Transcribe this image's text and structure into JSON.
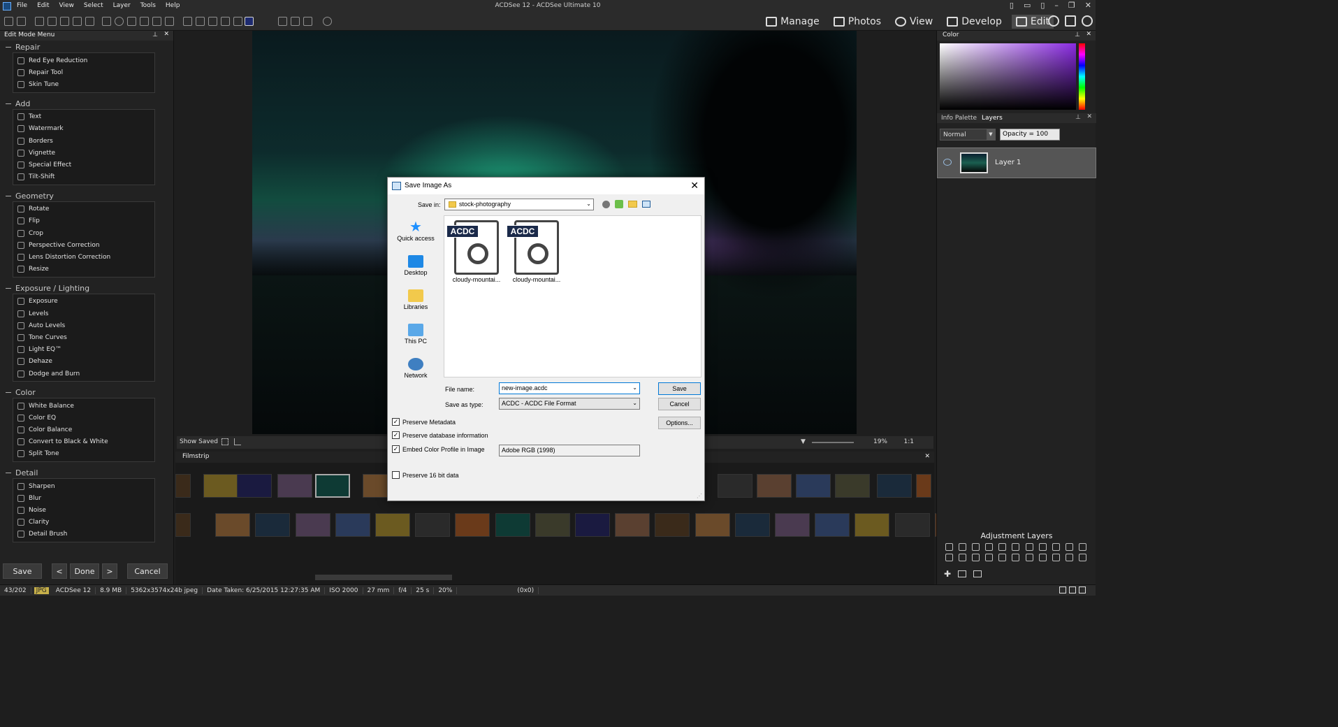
{
  "titlebar": {
    "menu": [
      "File",
      "Edit",
      "View",
      "Select",
      "Layer",
      "Tools",
      "Help"
    ],
    "title": "ACDSee 12 - ACDSee Ultimate 10"
  },
  "modes": [
    {
      "label": "Manage",
      "icon": "grid-icon"
    },
    {
      "label": "Photos",
      "icon": "photos-icon"
    },
    {
      "label": "View",
      "icon": "eye-icon"
    },
    {
      "label": "Develop",
      "icon": "develop-icon"
    },
    {
      "label": "Edit",
      "icon": "edit-icon",
      "active": true
    }
  ],
  "left_panel": {
    "title": "Edit Mode Menu",
    "groups": [
      {
        "name": "Repair",
        "items": [
          "Red Eye Reduction",
          "Repair Tool",
          "Skin Tune"
        ]
      },
      {
        "name": "Add",
        "items": [
          "Text",
          "Watermark",
          "Borders",
          "Vignette",
          "Special Effect",
          "Tilt-Shift"
        ]
      },
      {
        "name": "Geometry",
        "items": [
          "Rotate",
          "Flip",
          "Crop",
          "Perspective Correction",
          "Lens Distortion Correction",
          "Resize"
        ]
      },
      {
        "name": "Exposure / Lighting",
        "items": [
          "Exposure",
          "Levels",
          "Auto Levels",
          "Tone Curves",
          "Light EQ™",
          "Dehaze",
          "Dodge and Burn"
        ]
      },
      {
        "name": "Color",
        "items": [
          "White Balance",
          "Color EQ",
          "Color Balance",
          "Convert to Black & White",
          "Split Tone"
        ]
      },
      {
        "name": "Detail",
        "items": [
          "Sharpen",
          "Blur",
          "Noise",
          "Clarity",
          "Detail Brush"
        ]
      }
    ],
    "buttons": {
      "save": "Save",
      "prev": "<",
      "done": "Done",
      "next": ">",
      "cancel": "Cancel"
    }
  },
  "image_bar": {
    "show_saved": "Show Saved",
    "zoom": "19%",
    "ratio": "1:1"
  },
  "filmstrip": {
    "title": "Filmstrip"
  },
  "right_panel": {
    "color_title": "Color",
    "tabs": [
      "Info Palette",
      "Layers"
    ],
    "blend_mode": "Normal",
    "opacity": "Opacity = 100",
    "layer_name": "Layer 1",
    "adjustment_title": "Adjustment Layers"
  },
  "status": {
    "index": "43/202",
    "format": "JPG",
    "app": "ACDSee 12",
    "size": "8.9 MB",
    "dims": "5362x3574x24b jpeg",
    "date": "Date Taken: 6/25/2015 12:27:35 AM",
    "iso": "ISO 2000",
    "focal": "27 mm",
    "aperture": "f/4",
    "shutter": "25 s",
    "zoom": "20%",
    "coords": "(0x0)"
  },
  "dialog": {
    "title": "Save Image As",
    "save_in_label": "Save in:",
    "save_in_value": "stock-photography",
    "places": [
      "Quick access",
      "Desktop",
      "Libraries",
      "This PC",
      "Network"
    ],
    "files": [
      {
        "badge": "ACDC",
        "name": "cloudy-mountai..."
      },
      {
        "badge": "ACDC",
        "name": "cloudy-mountai..."
      }
    ],
    "file_name_label": "File name:",
    "file_name_value": "new-image.acdc",
    "save_type_label": "Save as type:",
    "save_type_value": "ACDC - ACDC File Format",
    "save_btn": "Save",
    "cancel_btn": "Cancel",
    "options_btn": "Options...",
    "preserve_metadata": "Preserve Metadata",
    "preserve_db": "Preserve database information",
    "embed_profile": "Embed Color Profile in Image",
    "profile_value": "Adobe RGB (1998)",
    "preserve_16bit": "Preserve 16 bit data"
  }
}
